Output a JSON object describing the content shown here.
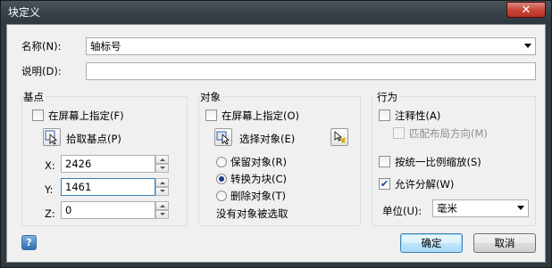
{
  "window": {
    "title": "块定义",
    "close_glyph": "✕"
  },
  "name_row": {
    "label": "名称(N):",
    "value": "轴标号"
  },
  "desc_row": {
    "label": "说明(D):",
    "value": ""
  },
  "basepoint": {
    "title": "基点",
    "onscreen_label": "在屏幕上指定(F)",
    "pick_label": "拾取基点(P)",
    "x_label": "X:",
    "x_value": "2426",
    "y_label": "Y:",
    "y_value": "1461",
    "z_label": "Z:",
    "z_value": "0"
  },
  "objects": {
    "title": "对象",
    "onscreen_label": "在屏幕上指定(O)",
    "select_label": "选择对象(E)",
    "retain_label": "保留对象(R)",
    "convert_label": "转换为块(C)",
    "delete_label": "删除对象(T)",
    "status": "没有对象被选取",
    "selected_option": "convert"
  },
  "behavior": {
    "title": "行为",
    "annotative_label": "注释性(A)",
    "match_orient_label": "匹配布局方向(M)",
    "uniform_label": "按统一比例缩放(S)",
    "explode_label": "允许分解(W)",
    "explode_checked": true,
    "unit_label": "单位(U):",
    "unit_value": "毫米"
  },
  "footer": {
    "ok_label": "确定",
    "cancel_label": "取消",
    "help_glyph": "?"
  },
  "colors": {
    "accent": "#1d3a8a",
    "close": "#c9473a"
  }
}
